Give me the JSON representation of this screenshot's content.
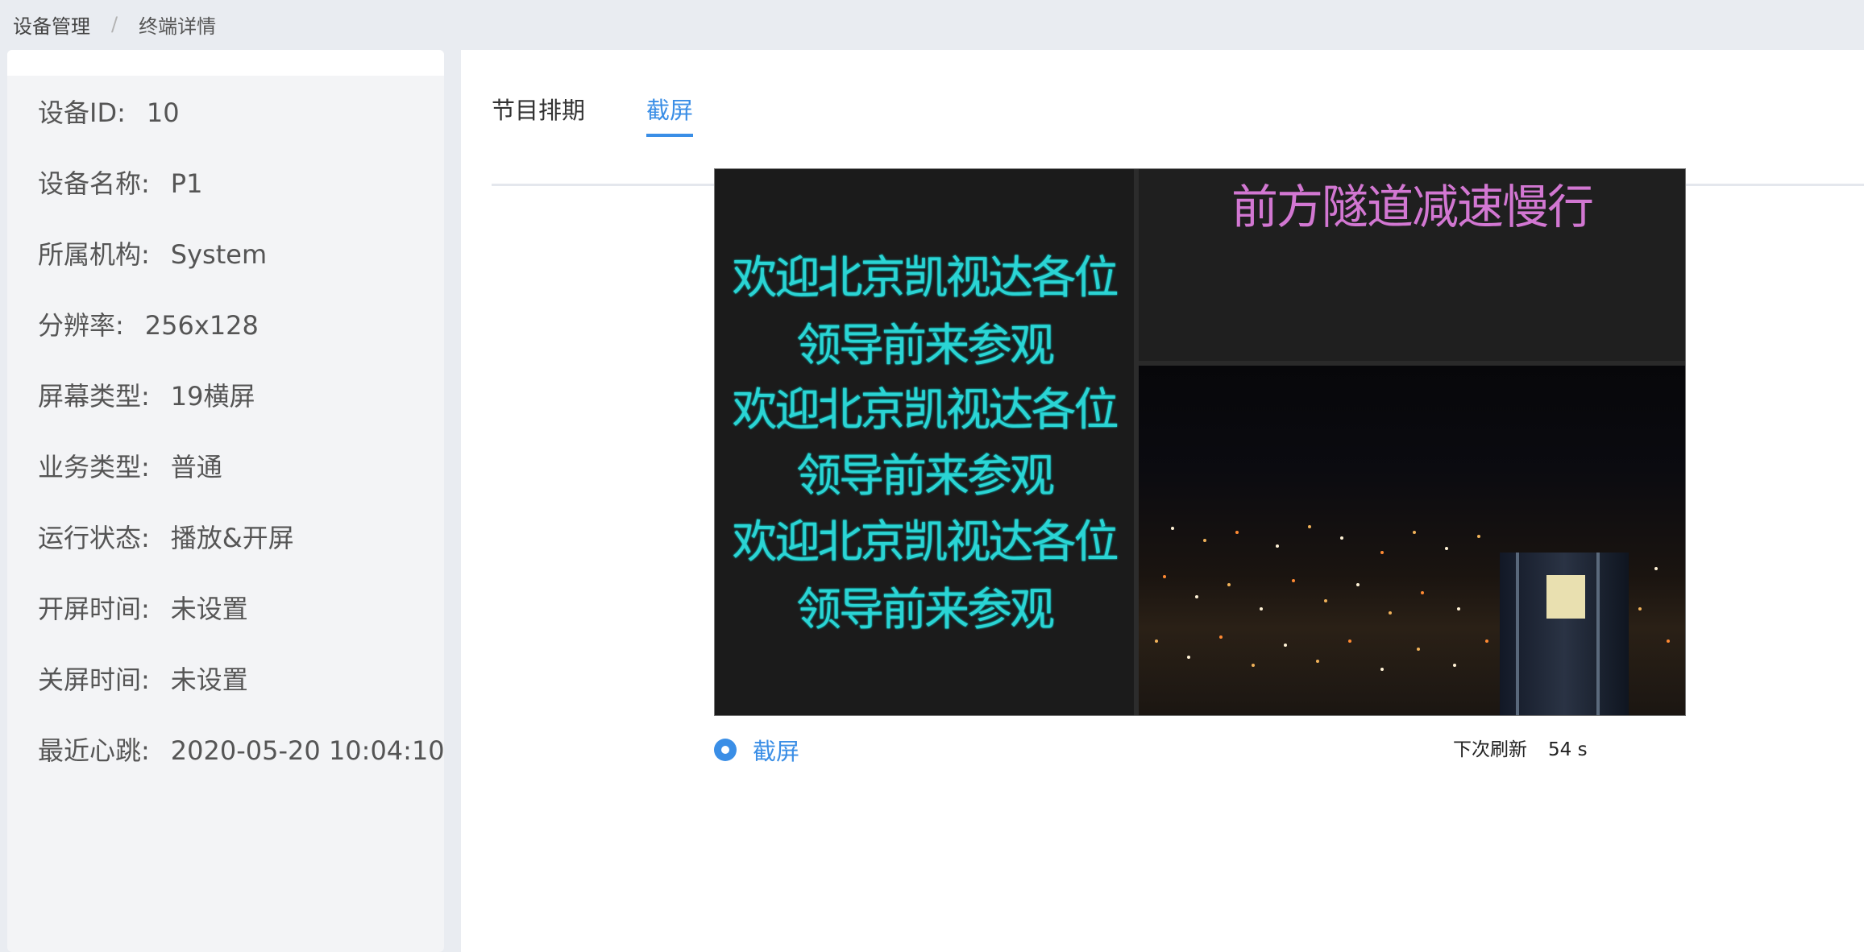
{
  "breadcrumb": {
    "root": "设备管理",
    "separator": "/",
    "current": "终端详情"
  },
  "device_info": [
    {
      "label": "设备ID:",
      "value": "10"
    },
    {
      "label": "设备名称:",
      "value": "P1"
    },
    {
      "label": "所属机构:",
      "value": "System"
    },
    {
      "label": "分辨率:",
      "value": "256x128"
    },
    {
      "label": "屏幕类型:",
      "value": "19横屏"
    },
    {
      "label": "业务类型:",
      "value": "普通"
    },
    {
      "label": "运行状态:",
      "value": "播放&开屏"
    },
    {
      "label": "开屏时间:",
      "value": "未设置"
    },
    {
      "label": "关屏时间:",
      "value": "未设置"
    },
    {
      "label": "最近心跳:",
      "value": "2020-05-20 10:04:10"
    }
  ],
  "tabs": [
    {
      "label": "节目排期",
      "active": false
    },
    {
      "label": "截屏",
      "active": true
    }
  ],
  "screenshot": {
    "left_lines": [
      "欢迎北京凯视达各位",
      "领导前来参观",
      "欢迎北京凯视达各位",
      "领导前来参观",
      "欢迎北京凯视达各位",
      "领导前来参观"
    ],
    "top_right_text": "前方隧道减速慢行"
  },
  "radio": {
    "label": "截屏",
    "selected": true
  },
  "refresh": {
    "label": "下次刷新",
    "count": "54 s"
  },
  "colors": {
    "accent": "#3a8ee6",
    "led_cyan": "#2bd4d4",
    "led_magenta": "#d277d2"
  }
}
